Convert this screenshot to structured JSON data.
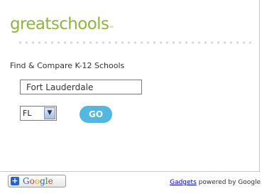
{
  "logo": {
    "part1": "great",
    "part2": "schools",
    "mark": "™"
  },
  "heading": "Find & Compare K-12 Schools",
  "search": {
    "city_value": "Fort Lauderdale",
    "state_value": "FL",
    "go_label": "GO"
  },
  "google_button": {
    "plus": "+",
    "letters": [
      "G",
      "o",
      "o",
      "g",
      "l",
      "e"
    ],
    "colors": [
      "#2a62c4",
      "#d2372b",
      "#e8a800",
      "#2a62c4",
      "#2f9a3e",
      "#d2372b"
    ]
  },
  "footer": {
    "gadgets_link": "Gadgets",
    "powered_by": " powered by Google"
  }
}
